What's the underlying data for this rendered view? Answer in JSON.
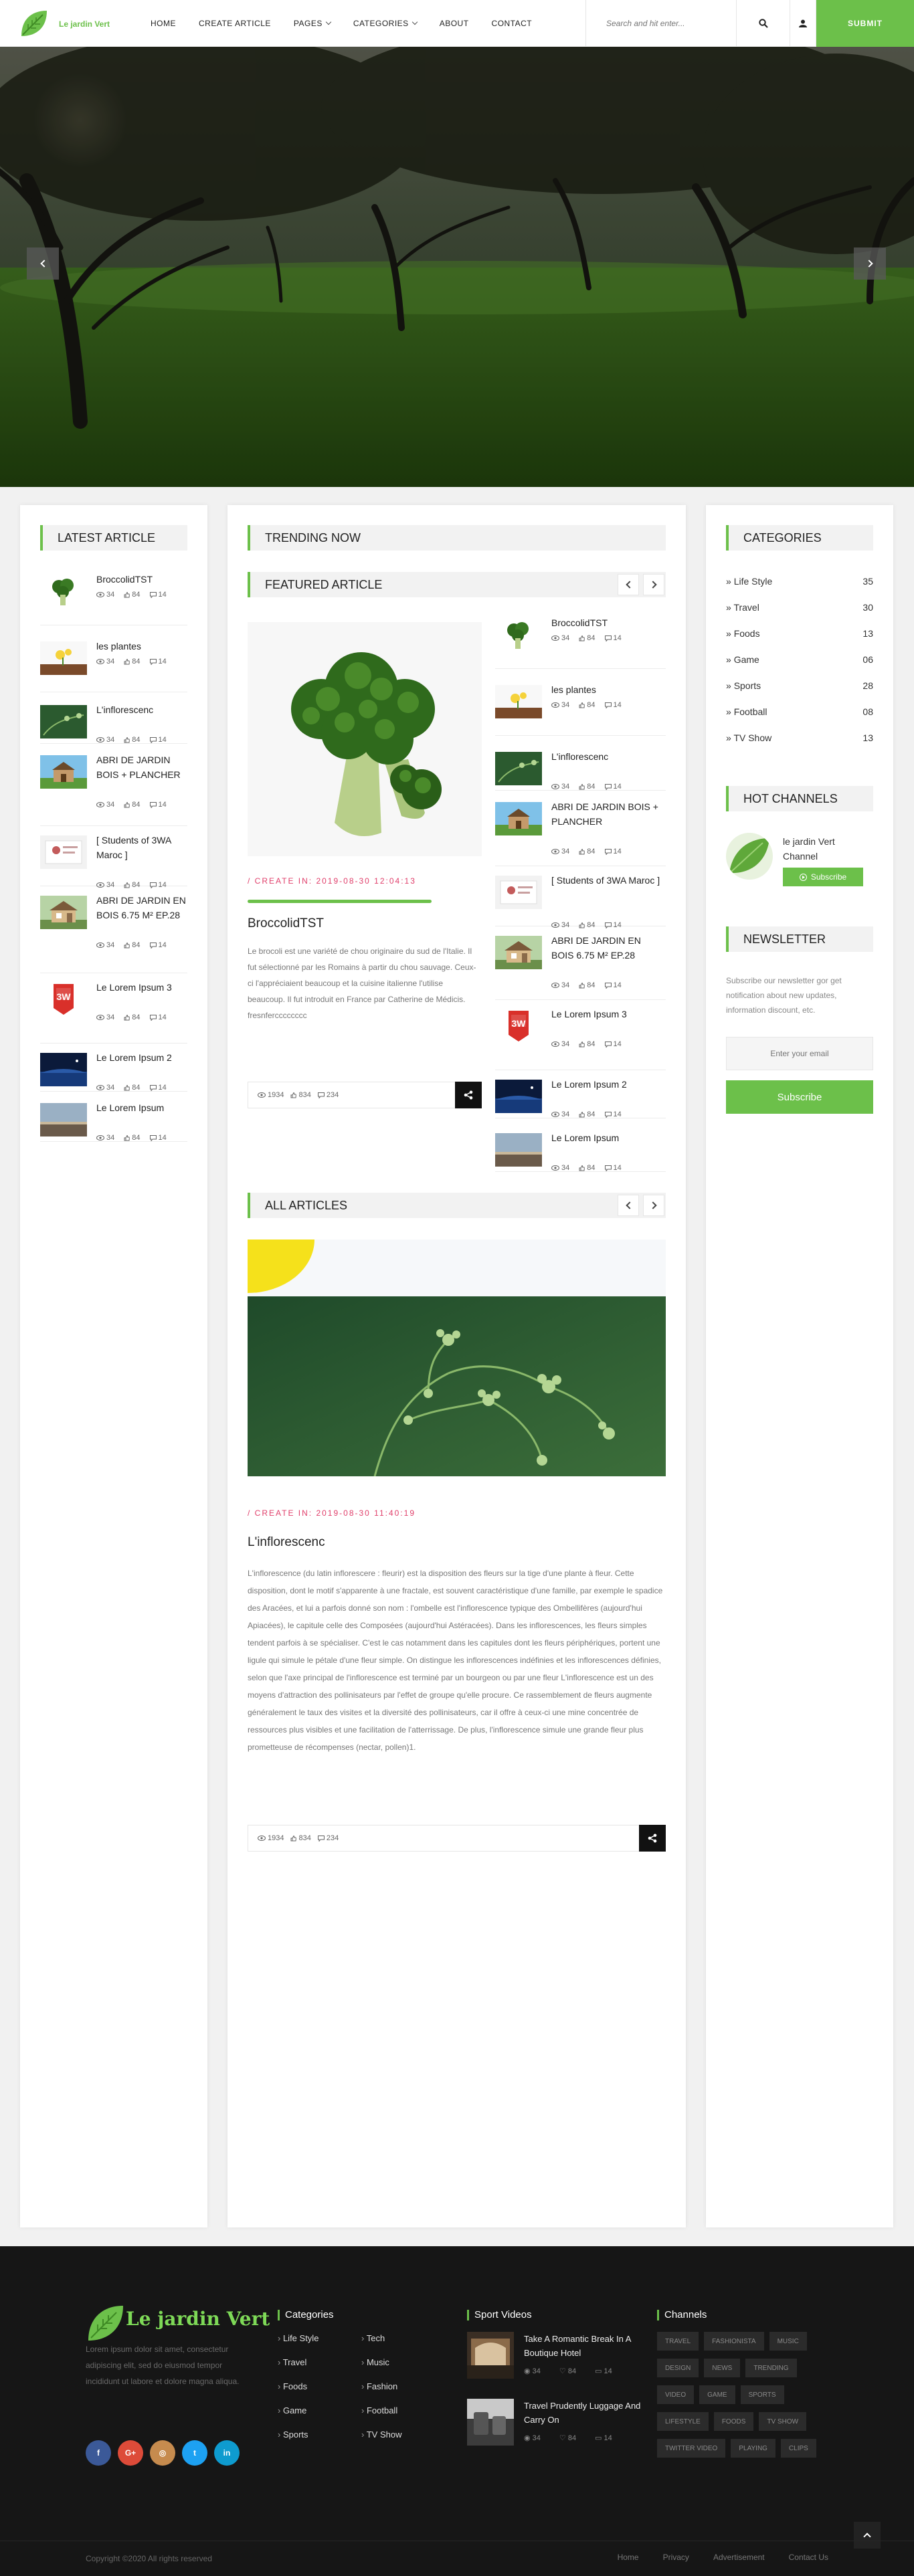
{
  "brand": {
    "name": "Le jardin Vert",
    "submit_label": "SUBMIT"
  },
  "nav": {
    "items": [
      {
        "label": "HOME"
      },
      {
        "label": "CREATE ARTICLE"
      },
      {
        "label": "PAGES"
      },
      {
        "label": "CATEGORIES"
      },
      {
        "label": "ABOUT"
      },
      {
        "label": "CONTACT"
      }
    ],
    "search_placeholder": "Search and hit enter..."
  },
  "latest": {
    "title": "LATEST ARTICLE",
    "items": [
      {
        "title": "BroccolidTST",
        "views": "34",
        "likes": "84",
        "comments": "14"
      },
      {
        "title": "les plantes",
        "views": "34",
        "likes": "84",
        "comments": "14"
      },
      {
        "title": "L'inflorescenc",
        "views": "34",
        "likes": "84",
        "comments": "14"
      },
      {
        "title": "ABRI DE JARDIN BOIS + PLANCHER",
        "views": "34",
        "likes": "84",
        "comments": "14"
      },
      {
        "title": "[ Students of 3WA Maroc ]",
        "views": "34",
        "likes": "84",
        "comments": "14"
      },
      {
        "title": "ABRI DE JARDIN EN BOIS 6.75 M² EP.28",
        "views": "34",
        "likes": "84",
        "comments": "14"
      },
      {
        "title": "Le Lorem Ipsum 3",
        "views": "34",
        "likes": "84",
        "comments": "14"
      },
      {
        "title": "Le Lorem Ipsum 2",
        "views": "34",
        "likes": "84",
        "comments": "14"
      },
      {
        "title": "Le Lorem Ipsum",
        "views": "34",
        "likes": "84",
        "comments": "14"
      }
    ]
  },
  "trending": {
    "title": "TRENDING NOW"
  },
  "featured": {
    "title": "FEATURED ARTICLE",
    "main": {
      "create_label": "/ CREATE IN: 2019-08-30 12:04:13",
      "title": "BroccolidTST",
      "excerpt": "Le brocoli est une variété de chou originaire du sud de l'Italie. Il fut sélectionné par les Romains à partir du chou sauvage. Ceux-ci l'appréciaient beaucoup et la cuisine italienne l'utilise beaucoup. Il fut introduit en France par Catherine de Médicis. fresnfercccccccc",
      "views": "1934",
      "likes": "834",
      "comments": "234"
    },
    "side": [
      {
        "title": "BroccolidTST",
        "views": "34",
        "likes": "84",
        "comments": "14"
      },
      {
        "title": "les plantes",
        "views": "34",
        "likes": "84",
        "comments": "14"
      },
      {
        "title": "L'inflorescenc",
        "views": "34",
        "likes": "84",
        "comments": "14"
      },
      {
        "title": "ABRI DE JARDIN BOIS + PLANCHER",
        "views": "34",
        "likes": "84",
        "comments": "14"
      },
      {
        "title": "[ Students of 3WA Maroc ]",
        "views": "34",
        "likes": "84",
        "comments": "14"
      },
      {
        "title": "ABRI DE JARDIN EN BOIS 6.75 M² EP.28",
        "views": "34",
        "likes": "84",
        "comments": "14"
      },
      {
        "title": "Le Lorem Ipsum 3",
        "views": "34",
        "likes": "84",
        "comments": "14"
      },
      {
        "title": "Le Lorem Ipsum 2",
        "views": "34",
        "likes": "84",
        "comments": "14"
      },
      {
        "title": "Le Lorem Ipsum",
        "views": "34",
        "likes": "84",
        "comments": "14"
      }
    ]
  },
  "all_articles": {
    "title": "ALL ARTICLES",
    "post": {
      "create_label": "/ CREATE IN: 2019-08-30 11:40:19",
      "title": "L'inflorescenc",
      "text": "L'inflorescence (du latin inflorescere : fleurir) est la disposition des fleurs sur la tige d'une plante à fleur. Cette disposition, dont le motif s'apparente à une fractale, est souvent caractéristique d'une famille, par exemple le spadice des Aracées, et lui a parfois donné son nom : l'ombelle est l'inflorescence typique des Ombellifères (aujourd'hui Apiacées), le capitule celle des Composées (aujourd'hui Astéracées). Dans les inflorescences, les fleurs simples tendent parfois à se spécialiser. C'est le cas notamment dans les capitules dont les fleurs périphériques, portent une ligule qui simule le pétale d'une fleur simple. On distingue les inflorescences indéfinies et les inflorescences définies, selon que l'axe principal de l'inflorescence est terminé par un bourgeon ou par une fleur L'inflorescence est un des moyens d'attraction des pollinisateurs par l'effet de groupe qu'elle procure. Ce rassemblement de fleurs augmente généralement le taux des visites et la diversité des pollinisateurs, car il offre à ceux-ci une mine concentrée de ressources plus visibles et une facilitation de l'atterrissage. De plus, l'inflorescence simule une grande fleur plus prometteuse de récompenses (nectar, pollen)1.",
      "views": "1934",
      "likes": "834",
      "comments": "234"
    }
  },
  "categories": {
    "title": "CATEGORIES",
    "items": [
      {
        "label": "Life Style",
        "count": "35"
      },
      {
        "label": "Travel",
        "count": "30"
      },
      {
        "label": "Foods",
        "count": "13"
      },
      {
        "label": "Game",
        "count": "06"
      },
      {
        "label": "Sports",
        "count": "28"
      },
      {
        "label": "Football",
        "count": "08"
      },
      {
        "label": "TV Show",
        "count": "13"
      }
    ]
  },
  "hot_channels": {
    "title": "HOT CHANNELS",
    "channel_name": "le jardin Vert Channel",
    "subscribe_label": "Subscribe"
  },
  "newsletter": {
    "title": "NEWSLETTER",
    "text": "Subscribe our newsletter gor get notification about new updates, information discount, etc.",
    "email_placeholder": "Enter your email",
    "button_label": "Subscribe"
  },
  "footer": {
    "brand": "Le jardin Vert",
    "about": "Lorem ipsum dolor sit amet, consectetur adipiscing elit, sed do eiusmod tempor incididunt ut labore et dolore magna aliqua.",
    "categories_title": "Categories",
    "categories_col1": [
      "Life Style",
      "Travel",
      "Foods",
      "Game",
      "Sports"
    ],
    "categories_col2": [
      "Tech",
      "Music",
      "Fashion",
      "Football",
      "TV Show"
    ],
    "videos_title": "Sport Videos",
    "videos": [
      {
        "title": "Take A Romantic Break In A Boutique Hotel",
        "views": "34",
        "likes": "84",
        "comments": "14"
      },
      {
        "title": "Travel Prudently Luggage And Carry On",
        "views": "34",
        "likes": "84",
        "comments": "14"
      }
    ],
    "channels_title": "Channels",
    "tags": [
      "TRAVEL",
      "FASHIONISTA",
      "MUSIC",
      "DESIGN",
      "NEWS",
      "TRENDING",
      "VIDEO",
      "GAME",
      "SPORTS",
      "LIFESTYLE",
      "FOODS",
      "TV SHOW",
      "TWITTER VIDEO",
      "PLAYING",
      "CLIPS"
    ],
    "copyright": "Copyright ©2020 All rights reserved",
    "links": [
      "Home",
      "Privacy",
      "Advertisement",
      "Contact Us"
    ]
  },
  "colors": {
    "accent": "#6cc04a",
    "date": "#e03e6a",
    "footer_bg": "#161616"
  }
}
